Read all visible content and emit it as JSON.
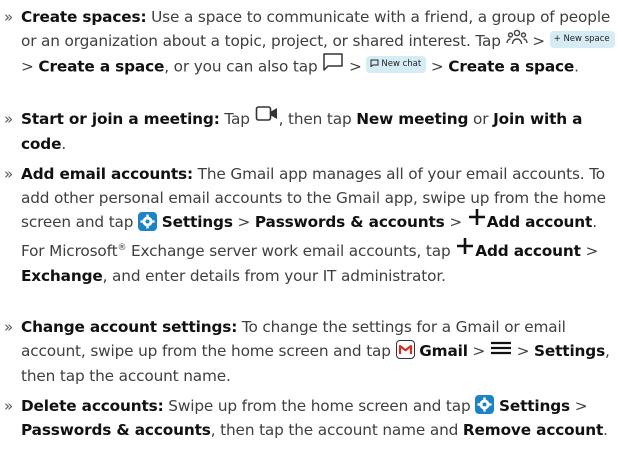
{
  "items": [
    {
      "title": "Create spaces:",
      "t1": " Use a space to communicate with a friend, a group of people or an organization about a topic, project, or shared interest. Tap ",
      "t2": " > ",
      "chip_new_space": "+ New space",
      "t3": " > ",
      "b_create_space": "Create a space",
      "t4": ", or you can also tap ",
      "t5": " > ",
      "chip_new_chat": "New chat",
      "t6": " > ",
      "b_create_space2": "Create a space",
      "t7": "."
    },
    {
      "title": "Start or join a meeting:",
      "t1": " Tap ",
      "t2": ", then tap ",
      "b_new_meeting": "New meeting",
      "t3": " or ",
      "b_join_code": "Join with a code",
      "t4": "."
    },
    {
      "title": "Add email accounts:",
      "t1": " The Gmail app manages all of your email accounts. To add other personal email accounts to the Gmail app, swipe up from the home screen and tap ",
      "b_settings": "Settings",
      "t2": " > ",
      "b_passwords": "Passwords & accounts",
      "t3": " > ",
      "b_add_account": "Add account",
      "t4": ". For Microsoft",
      "reg": "®",
      "t5": " Exchange server work email accounts, tap ",
      "b_add_account2": "Add account",
      "t6": " > ",
      "b_exchange": "Exchange",
      "t7": ", and enter details from your IT administrator."
    },
    {
      "title": "Change account settings:",
      "t1": " To change the settings for a Gmail or email account, swipe up from the home screen and tap ",
      "b_gmail": "Gmail",
      "t2": " > ",
      "t3": " > ",
      "b_settings": "Settings",
      "t4": ", then tap the account name."
    },
    {
      "title": "Delete accounts:",
      "t1": " Swipe up from the home screen and tap ",
      "b_settings": "Settings",
      "t2": " > ",
      "b_passwords": "Passwords & accounts",
      "t3": ", then tap the account name and ",
      "b_remove": "Remove account",
      "t4": "."
    }
  ],
  "bullet": "»",
  "colors": {
    "chip_bg": "#d6ecf4",
    "settings_icon": "#1c84c6",
    "gmail_red": "#d93025"
  },
  "icons": [
    "people-icon",
    "chat-bubble-icon",
    "video-camera-icon",
    "plus-icon",
    "settings-gear-icon",
    "gmail-icon",
    "menu-icon"
  ]
}
